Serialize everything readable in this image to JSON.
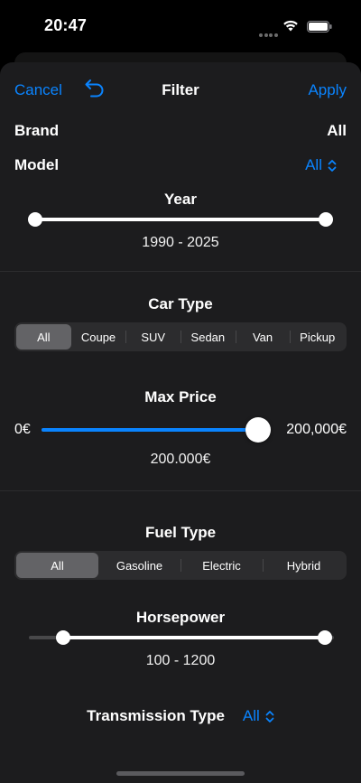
{
  "status": {
    "time": "20:47"
  },
  "nav": {
    "cancel": "Cancel",
    "title": "Filter",
    "apply": "Apply"
  },
  "brand": {
    "label": "Brand",
    "value": "All"
  },
  "model": {
    "label": "Model",
    "value": "All"
  },
  "year": {
    "title": "Year",
    "range": "1990 - 2025",
    "min": 1990,
    "max": 2025
  },
  "car_type": {
    "title": "Car Type",
    "options": [
      "All",
      "Coupe",
      "SUV",
      "Sedan",
      "Van",
      "Pickup"
    ],
    "selected": "All"
  },
  "max_price": {
    "title": "Max Price",
    "min_label": "0€",
    "max_label": "200,000€",
    "value_text": "200.000€",
    "fraction": 1.0
  },
  "fuel_type": {
    "title": "Fuel Type",
    "options": [
      "All",
      "Gasoline",
      "Electric",
      "Hybrid"
    ],
    "selected": "All"
  },
  "horsepower": {
    "title": "Horsepower",
    "range": "100 - 1200",
    "low_fraction": 0.1,
    "high_fraction": 1.0
  },
  "transmission": {
    "label": "Transmission Type",
    "value": "All"
  },
  "colors": {
    "accent": "#0a84ff",
    "sheet": "#1c1c1e",
    "control": "#2c2c2e",
    "selected_segment": "#636366"
  }
}
